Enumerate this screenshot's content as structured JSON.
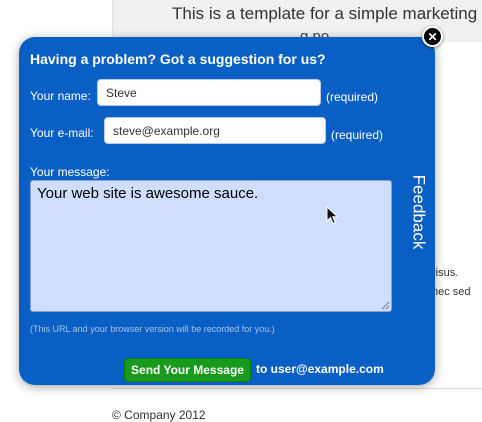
{
  "background_page": {
    "headline": "This is a template for a simple marketing",
    "headline_line2": "g po",
    "fragment_link": "·",
    "fragment_1": "risus.",
    "fragment_2": "nec sed",
    "footer": "© Company 2012"
  },
  "feedback_form": {
    "title": "Having a problem? Got a suggestion for us?",
    "name_label": "Your name:",
    "name_value": "Steve",
    "name_required": "(required)",
    "email_label": "Your e-mail:",
    "email_value": "steve@example.org",
    "email_required": "(required)",
    "message_label": "Your message:",
    "message_value": "Your web site is awesome sauce.",
    "note": "(This URL and your browser version will be recorded for you.)",
    "send_label": "Send Your Message",
    "send_to": "to user@example.com",
    "tab_label": "Feedback",
    "close_glyph": "✕"
  },
  "colors": {
    "modal_blue": "#0a5fc4",
    "textarea_bg": "#cfdeff",
    "send_green": "#189a1c"
  },
  "icons": {
    "close": "close-icon",
    "cursor": "mouse-pointer-icon",
    "resize": "resize-grip-icon"
  }
}
